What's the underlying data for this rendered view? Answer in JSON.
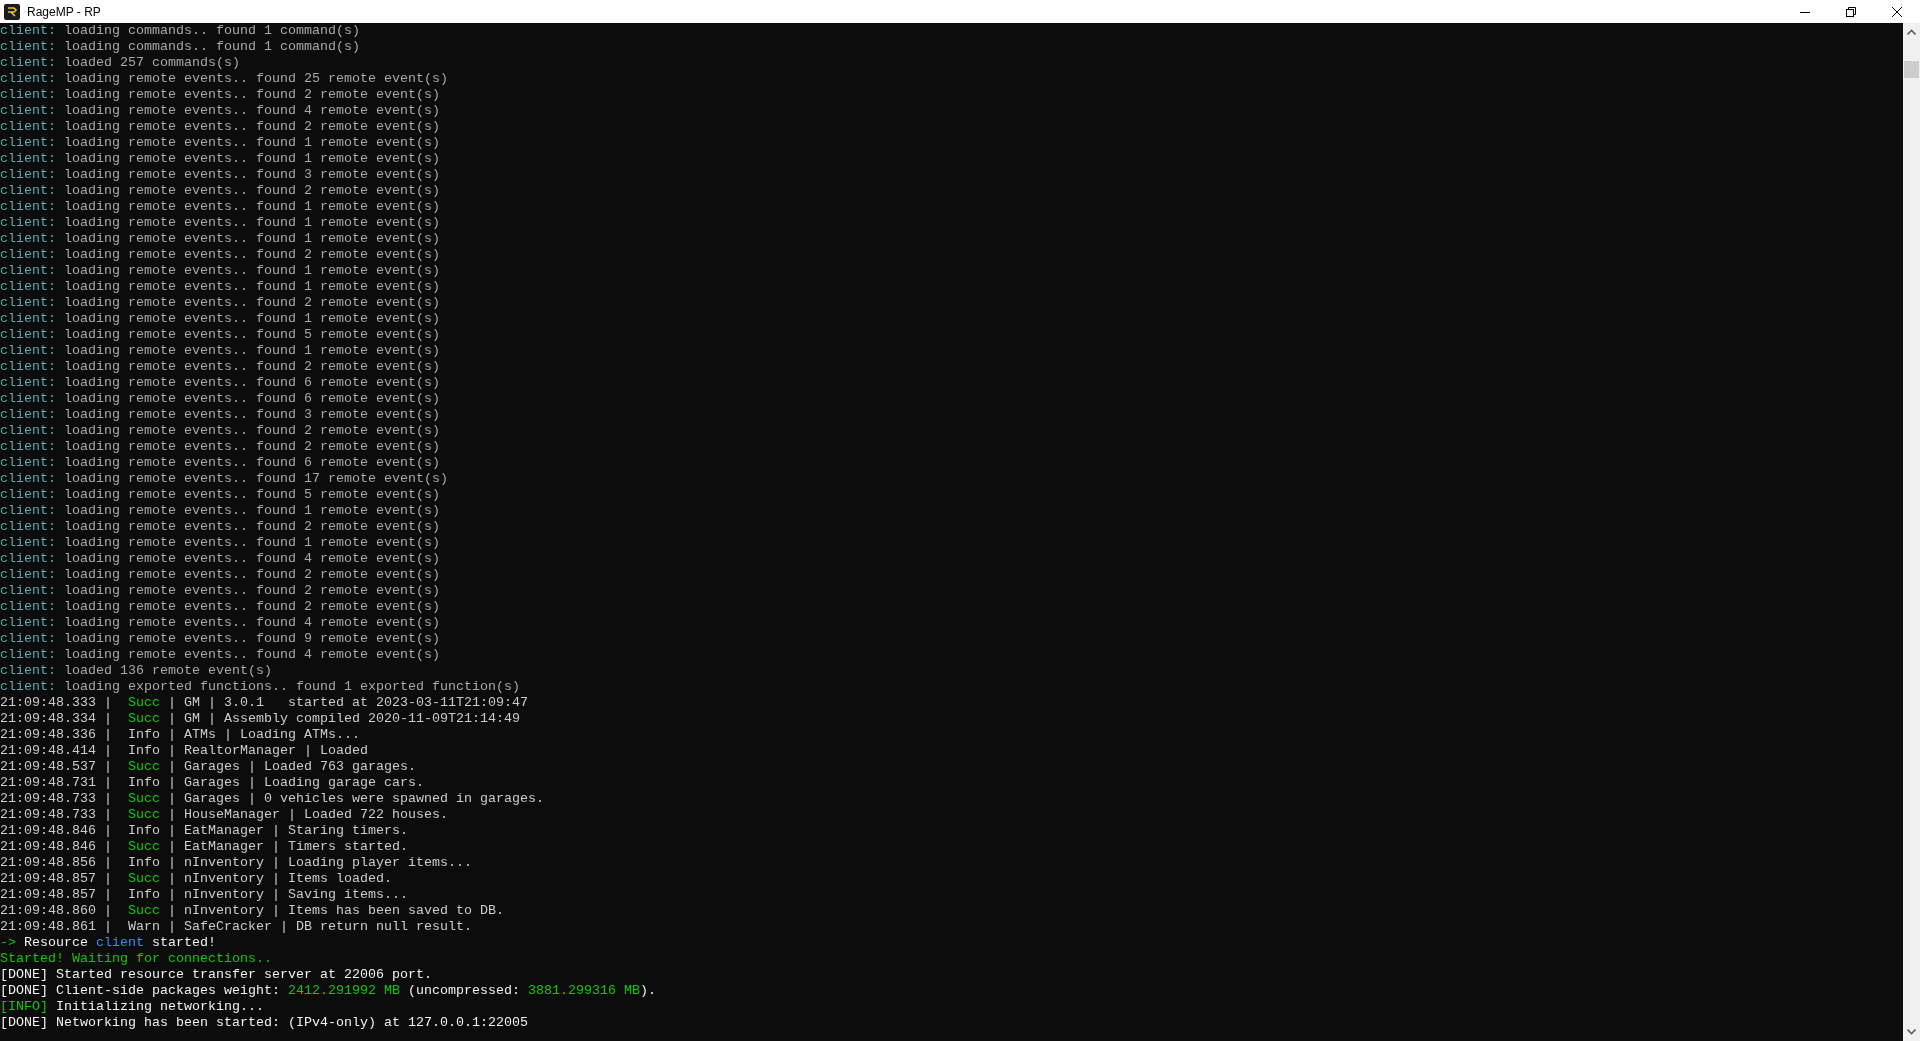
{
  "window": {
    "title": "RageMP - RP"
  },
  "console": {
    "lines": [
      {
        "segments": [
          {
            "text": "client:",
            "color": "#61a8ac"
          },
          {
            "text": " loading commands.. found 1 command(s)",
            "color": "#a8a8a8"
          }
        ]
      },
      {
        "segments": [
          {
            "text": "client:",
            "color": "#61a8ac"
          },
          {
            "text": " loading commands.. found 1 command(s)",
            "color": "#a8a8a8"
          }
        ]
      },
      {
        "segments": [
          {
            "text": "client:",
            "color": "#61a8ac"
          },
          {
            "text": " loaded 257 commands(s)",
            "color": "#a8a8a8"
          }
        ]
      },
      {
        "segments": [
          {
            "text": "client:",
            "color": "#61a8ac"
          },
          {
            "text": " loading remote events.. found 25 remote event(s)",
            "color": "#a8a8a8"
          }
        ]
      },
      {
        "segments": [
          {
            "text": "client:",
            "color": "#61a8ac"
          },
          {
            "text": " loading remote events.. found 2 remote event(s)",
            "color": "#a8a8a8"
          }
        ]
      },
      {
        "segments": [
          {
            "text": "client:",
            "color": "#61a8ac"
          },
          {
            "text": " loading remote events.. found 4 remote event(s)",
            "color": "#a8a8a8"
          }
        ]
      },
      {
        "segments": [
          {
            "text": "client:",
            "color": "#61a8ac"
          },
          {
            "text": " loading remote events.. found 2 remote event(s)",
            "color": "#a8a8a8"
          }
        ]
      },
      {
        "segments": [
          {
            "text": "client:",
            "color": "#61a8ac"
          },
          {
            "text": " loading remote events.. found 1 remote event(s)",
            "color": "#a8a8a8"
          }
        ]
      },
      {
        "segments": [
          {
            "text": "client:",
            "color": "#61a8ac"
          },
          {
            "text": " loading remote events.. found 1 remote event(s)",
            "color": "#a8a8a8"
          }
        ]
      },
      {
        "segments": [
          {
            "text": "client:",
            "color": "#61a8ac"
          },
          {
            "text": " loading remote events.. found 3 remote event(s)",
            "color": "#a8a8a8"
          }
        ]
      },
      {
        "segments": [
          {
            "text": "client:",
            "color": "#61a8ac"
          },
          {
            "text": " loading remote events.. found 2 remote event(s)",
            "color": "#a8a8a8"
          }
        ]
      },
      {
        "segments": [
          {
            "text": "client:",
            "color": "#61a8ac"
          },
          {
            "text": " loading remote events.. found 1 remote event(s)",
            "color": "#a8a8a8"
          }
        ]
      },
      {
        "segments": [
          {
            "text": "client:",
            "color": "#61a8ac"
          },
          {
            "text": " loading remote events.. found 1 remote event(s)",
            "color": "#a8a8a8"
          }
        ]
      },
      {
        "segments": [
          {
            "text": "client:",
            "color": "#61a8ac"
          },
          {
            "text": " loading remote events.. found 1 remote event(s)",
            "color": "#a8a8a8"
          }
        ]
      },
      {
        "segments": [
          {
            "text": "client:",
            "color": "#61a8ac"
          },
          {
            "text": " loading remote events.. found 2 remote event(s)",
            "color": "#a8a8a8"
          }
        ]
      },
      {
        "segments": [
          {
            "text": "client:",
            "color": "#61a8ac"
          },
          {
            "text": " loading remote events.. found 1 remote event(s)",
            "color": "#a8a8a8"
          }
        ]
      },
      {
        "segments": [
          {
            "text": "client:",
            "color": "#61a8ac"
          },
          {
            "text": " loading remote events.. found 1 remote event(s)",
            "color": "#a8a8a8"
          }
        ]
      },
      {
        "segments": [
          {
            "text": "client:",
            "color": "#61a8ac"
          },
          {
            "text": " loading remote events.. found 2 remote event(s)",
            "color": "#a8a8a8"
          }
        ]
      },
      {
        "segments": [
          {
            "text": "client:",
            "color": "#61a8ac"
          },
          {
            "text": " loading remote events.. found 1 remote event(s)",
            "color": "#a8a8a8"
          }
        ]
      },
      {
        "segments": [
          {
            "text": "client:",
            "color": "#61a8ac"
          },
          {
            "text": " loading remote events.. found 5 remote event(s)",
            "color": "#a8a8a8"
          }
        ]
      },
      {
        "segments": [
          {
            "text": "client:",
            "color": "#61a8ac"
          },
          {
            "text": " loading remote events.. found 1 remote event(s)",
            "color": "#a8a8a8"
          }
        ]
      },
      {
        "segments": [
          {
            "text": "client:",
            "color": "#61a8ac"
          },
          {
            "text": " loading remote events.. found 2 remote event(s)",
            "color": "#a8a8a8"
          }
        ]
      },
      {
        "segments": [
          {
            "text": "client:",
            "color": "#61a8ac"
          },
          {
            "text": " loading remote events.. found 6 remote event(s)",
            "color": "#a8a8a8"
          }
        ]
      },
      {
        "segments": [
          {
            "text": "client:",
            "color": "#61a8ac"
          },
          {
            "text": " loading remote events.. found 6 remote event(s)",
            "color": "#a8a8a8"
          }
        ]
      },
      {
        "segments": [
          {
            "text": "client:",
            "color": "#61a8ac"
          },
          {
            "text": " loading remote events.. found 3 remote event(s)",
            "color": "#a8a8a8"
          }
        ]
      },
      {
        "segments": [
          {
            "text": "client:",
            "color": "#61a8ac"
          },
          {
            "text": " loading remote events.. found 2 remote event(s)",
            "color": "#a8a8a8"
          }
        ]
      },
      {
        "segments": [
          {
            "text": "client:",
            "color": "#61a8ac"
          },
          {
            "text": " loading remote events.. found 2 remote event(s)",
            "color": "#a8a8a8"
          }
        ]
      },
      {
        "segments": [
          {
            "text": "client:",
            "color": "#61a8ac"
          },
          {
            "text": " loading remote events.. found 6 remote event(s)",
            "color": "#a8a8a8"
          }
        ]
      },
      {
        "segments": [
          {
            "text": "client:",
            "color": "#61a8ac"
          },
          {
            "text": " loading remote events.. found 17 remote event(s)",
            "color": "#a8a8a8"
          }
        ]
      },
      {
        "segments": [
          {
            "text": "client:",
            "color": "#61a8ac"
          },
          {
            "text": " loading remote events.. found 5 remote event(s)",
            "color": "#a8a8a8"
          }
        ]
      },
      {
        "segments": [
          {
            "text": "client:",
            "color": "#61a8ac"
          },
          {
            "text": " loading remote events.. found 1 remote event(s)",
            "color": "#a8a8a8"
          }
        ]
      },
      {
        "segments": [
          {
            "text": "client:",
            "color": "#61a8ac"
          },
          {
            "text": " loading remote events.. found 2 remote event(s)",
            "color": "#a8a8a8"
          }
        ]
      },
      {
        "segments": [
          {
            "text": "client:",
            "color": "#61a8ac"
          },
          {
            "text": " loading remote events.. found 1 remote event(s)",
            "color": "#a8a8a8"
          }
        ]
      },
      {
        "segments": [
          {
            "text": "client:",
            "color": "#61a8ac"
          },
          {
            "text": " loading remote events.. found 4 remote event(s)",
            "color": "#a8a8a8"
          }
        ]
      },
      {
        "segments": [
          {
            "text": "client:",
            "color": "#61a8ac"
          },
          {
            "text": " loading remote events.. found 2 remote event(s)",
            "color": "#a8a8a8"
          }
        ]
      },
      {
        "segments": [
          {
            "text": "client:",
            "color": "#61a8ac"
          },
          {
            "text": " loading remote events.. found 2 remote event(s)",
            "color": "#a8a8a8"
          }
        ]
      },
      {
        "segments": [
          {
            "text": "client:",
            "color": "#61a8ac"
          },
          {
            "text": " loading remote events.. found 2 remote event(s)",
            "color": "#a8a8a8"
          }
        ]
      },
      {
        "segments": [
          {
            "text": "client:",
            "color": "#61a8ac"
          },
          {
            "text": " loading remote events.. found 4 remote event(s)",
            "color": "#a8a8a8"
          }
        ]
      },
      {
        "segments": [
          {
            "text": "client:",
            "color": "#61a8ac"
          },
          {
            "text": " loading remote events.. found 9 remote event(s)",
            "color": "#a8a8a8"
          }
        ]
      },
      {
        "segments": [
          {
            "text": "client:",
            "color": "#61a8ac"
          },
          {
            "text": " loading remote events.. found 4 remote event(s)",
            "color": "#a8a8a8"
          }
        ]
      },
      {
        "segments": [
          {
            "text": "client:",
            "color": "#61a8ac"
          },
          {
            "text": " loaded 136 remote event(s)",
            "color": "#a8a8a8"
          }
        ]
      },
      {
        "segments": [
          {
            "text": "client:",
            "color": "#61a8ac"
          },
          {
            "text": " loading exported functions.. found 1 exported function(s)",
            "color": "#a8a8a8"
          }
        ]
      },
      {
        "segments": [
          {
            "text": "21:09:48.333 |  ",
            "color": "#cccccc"
          },
          {
            "text": "Succ",
            "color": "#16c60c"
          },
          {
            "text": " | GM | 3.0.1   started at 2023-03-11T21:09:47",
            "color": "#cccccc"
          }
        ]
      },
      {
        "segments": [
          {
            "text": "21:09:48.334 |  ",
            "color": "#cccccc"
          },
          {
            "text": "Succ",
            "color": "#16c60c"
          },
          {
            "text": " | GM | Assembly compiled 2020-11-09T21:14:49",
            "color": "#cccccc"
          }
        ]
      },
      {
        "segments": [
          {
            "text": "21:09:48.336 |  Info | ATMs | Loading ATMs...",
            "color": "#cccccc"
          }
        ]
      },
      {
        "segments": [
          {
            "text": "21:09:48.414 |  Info | RealtorManager | Loaded",
            "color": "#cccccc"
          }
        ]
      },
      {
        "segments": [
          {
            "text": "21:09:48.537 |  ",
            "color": "#cccccc"
          },
          {
            "text": "Succ",
            "color": "#16c60c"
          },
          {
            "text": " | Garages | Loaded 763 garages.",
            "color": "#cccccc"
          }
        ]
      },
      {
        "segments": [
          {
            "text": "21:09:48.731 |  Info | Garages | Loading garage cars.",
            "color": "#cccccc"
          }
        ]
      },
      {
        "segments": [
          {
            "text": "21:09:48.733 |  ",
            "color": "#cccccc"
          },
          {
            "text": "Succ",
            "color": "#16c60c"
          },
          {
            "text": " | Garages | 0 vehicles were spawned in garages.",
            "color": "#cccccc"
          }
        ]
      },
      {
        "segments": [
          {
            "text": "21:09:48.733 |  ",
            "color": "#cccccc"
          },
          {
            "text": "Succ",
            "color": "#16c60c"
          },
          {
            "text": " | HouseManager | Loaded 722 houses.",
            "color": "#cccccc"
          }
        ]
      },
      {
        "segments": [
          {
            "text": "21:09:48.846 |  Info | EatManager | Staring timers.",
            "color": "#cccccc"
          }
        ]
      },
      {
        "segments": [
          {
            "text": "21:09:48.846 |  ",
            "color": "#cccccc"
          },
          {
            "text": "Succ",
            "color": "#16c60c"
          },
          {
            "text": " | EatManager | Timers started.",
            "color": "#cccccc"
          }
        ]
      },
      {
        "segments": [
          {
            "text": "21:09:48.856 |  Info | nInventory | Loading player items...",
            "color": "#cccccc"
          }
        ]
      },
      {
        "segments": [
          {
            "text": "21:09:48.857 |  ",
            "color": "#cccccc"
          },
          {
            "text": "Succ",
            "color": "#16c60c"
          },
          {
            "text": " | nInventory | Items loaded.",
            "color": "#cccccc"
          }
        ]
      },
      {
        "segments": [
          {
            "text": "21:09:48.857 |  Info | nInventory | Saving items...",
            "color": "#cccccc"
          }
        ]
      },
      {
        "segments": [
          {
            "text": "21:09:48.860 |  ",
            "color": "#cccccc"
          },
          {
            "text": "Succ",
            "color": "#16c60c"
          },
          {
            "text": " | nInventory | Items has been saved to DB.",
            "color": "#cccccc"
          }
        ]
      },
      {
        "segments": [
          {
            "text": "21:09:48.861 |  Warn | SafeCracker | DB return null result.",
            "color": "#cccccc"
          }
        ]
      },
      {
        "segments": [
          {
            "text": "->",
            "color": "#16c60c"
          },
          {
            "text": " Resource ",
            "color": "#f2f2f2"
          },
          {
            "text": "client",
            "color": "#3b8eea"
          },
          {
            "text": " started!",
            "color": "#f2f2f2"
          }
        ]
      },
      {
        "segments": [
          {
            "text": "Started! Waiting for connections..",
            "color": "#16c60c"
          }
        ]
      },
      {
        "segments": [
          {
            "text": "[DONE] Started resource transfer server at 22006 port.",
            "color": "#f2f2f2"
          }
        ]
      },
      {
        "segments": [
          {
            "text": "[DONE] Client-side packages weight: ",
            "color": "#f2f2f2"
          },
          {
            "text": "2412.291992 MB",
            "color": "#16c60c"
          },
          {
            "text": " (uncompressed: ",
            "color": "#f2f2f2"
          },
          {
            "text": "3881.299316 MB",
            "color": "#16c60c"
          },
          {
            "text": ")."
          }
        ]
      },
      {
        "segments": [
          {
            "text": "[INFO]",
            "color": "#16c60c"
          },
          {
            "text": " Initializing networking...",
            "color": "#f2f2f2"
          }
        ]
      },
      {
        "segments": [
          {
            "text": "[DONE] Networking has been started: (IPv4-only) at 127.0.0.1:22005",
            "color": "#f2f2f2"
          }
        ]
      }
    ]
  }
}
